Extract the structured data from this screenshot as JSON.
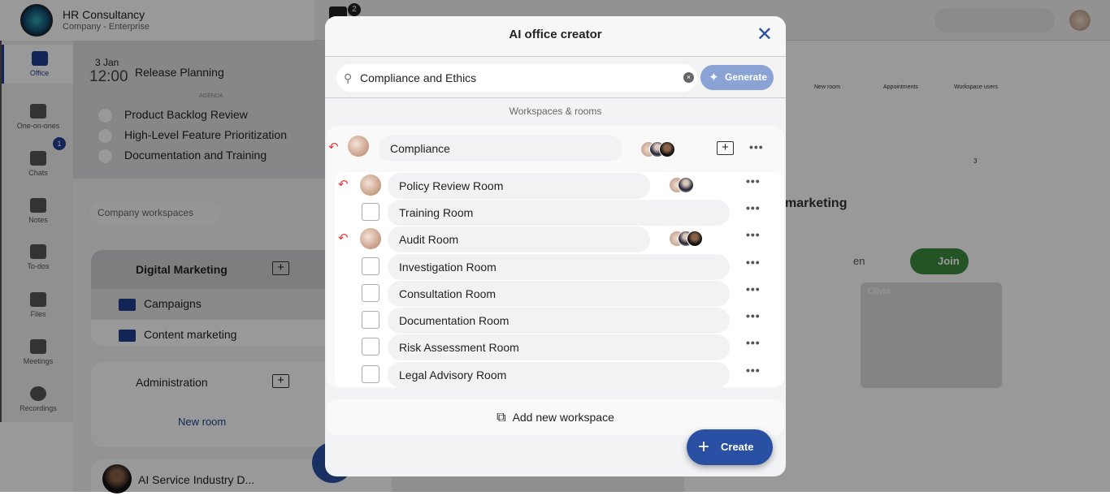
{
  "company": {
    "name": "HR Consultancy",
    "plan": "Company - Enterprise",
    "calendar_badge": "2"
  },
  "sidebar": {
    "items": [
      {
        "label": "Office",
        "icon": "briefcase-icon",
        "active": true
      },
      {
        "label": "One-on-ones",
        "icon": "users-icon"
      },
      {
        "label": "Chats",
        "icon": "chat-icon",
        "badge": "1"
      },
      {
        "label": "Notes",
        "icon": "notes-icon"
      },
      {
        "label": "To-dos",
        "icon": "checkbox-icon"
      },
      {
        "label": "Files",
        "icon": "files-icon"
      },
      {
        "label": "Meetings",
        "icon": "meetings-icon"
      },
      {
        "label": "Recordings",
        "icon": "recordings-icon"
      }
    ]
  },
  "meeting": {
    "date": "3 Jan",
    "time": "12:00",
    "title": "Release Planning",
    "agenda_label": "AGENDA",
    "agenda": [
      "Product Backlog Review",
      "High-Level Feature Prioritization",
      "Documentation and Training"
    ]
  },
  "workspaces": {
    "filter": "Company workspaces",
    "list": [
      {
        "name": "Digital Marketing",
        "rooms": [
          "Campaigns",
          "Content marketing"
        ]
      },
      {
        "name": "Administration",
        "new_room": "New room"
      },
      {
        "name": "AI Service Industry D..."
      }
    ]
  },
  "toolbar": {
    "new_room": "New room",
    "appointments": "Appointments",
    "workspace_users": "Workspace users"
  },
  "room_card": {
    "title": "marketing",
    "participants_count": "3",
    "language": "en",
    "join": "Join",
    "tile_name": "Olivia"
  },
  "modal": {
    "title": "AI office creator",
    "search_value": "Compliance and Ethics",
    "generate": "Generate",
    "section_label": "Workspaces & rooms",
    "workspace": {
      "name": "Compliance",
      "users": 3
    },
    "rooms": [
      {
        "name": "Policy Review Room",
        "assigned": true,
        "users": 2
      },
      {
        "name": "Training Room",
        "assigned": false
      },
      {
        "name": "Audit Room",
        "assigned": true,
        "users": 3
      },
      {
        "name": "Investigation Room",
        "assigned": false
      },
      {
        "name": "Consultation Room",
        "assigned": false
      },
      {
        "name": "Documentation Room",
        "assigned": false
      },
      {
        "name": "Risk Assessment Room",
        "assigned": false
      },
      {
        "name": "Legal Advisory Room",
        "assigned": false
      }
    ],
    "add_workspace": "Add new workspace",
    "create": "Create"
  },
  "colors": {
    "accent": "#2a50a3",
    "generate": "#8aa2d4",
    "undo": "#e53935",
    "join": "#3c8a3e"
  }
}
